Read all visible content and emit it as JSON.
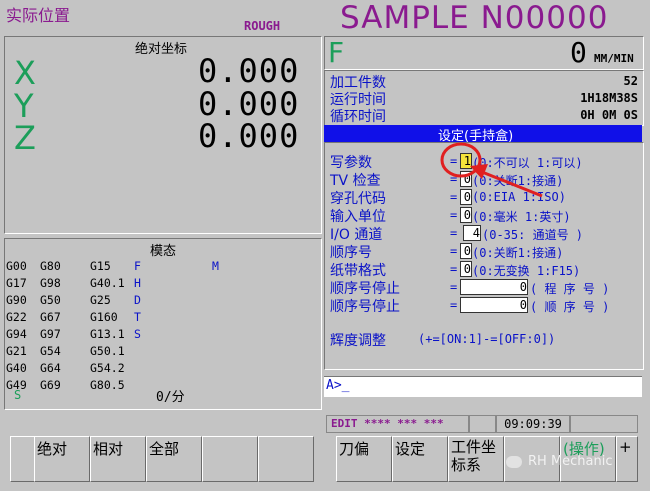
{
  "header": {
    "screen_title": "实际位置",
    "mode": "ROUGH",
    "program": "SAMPLE N00000"
  },
  "absolute": {
    "title": "绝对坐标",
    "axes": [
      {
        "letter": "X",
        "value": "0.000"
      },
      {
        "letter": "Y",
        "value": "0.000"
      },
      {
        "letter": "Z",
        "value": "0.000"
      }
    ]
  },
  "feed": {
    "letter": "F",
    "value": "0",
    "unit": "MM/MIN"
  },
  "info": [
    {
      "label": "加工件数",
      "value": "52"
    },
    {
      "label": "运行时间",
      "value": "1H18M38S"
    },
    {
      "label": "循环时间",
      "value": "0H 0M 0S"
    }
  ],
  "settings": {
    "title": "设定(手持盒)",
    "rows": [
      {
        "label": "写参数",
        "value": "1",
        "desc": "(0:不可以    1:可以)"
      },
      {
        "label": "TV  检查",
        "value": "0",
        "desc": "(0:关断1:接通)"
      },
      {
        "label": "穿孔代码",
        "value": "0",
        "desc": "(0:EIA    1:ISO)"
      },
      {
        "label": "输入单位",
        "value": "0",
        "desc": "(0:毫米    1:英寸)"
      },
      {
        "label": "I/O  通道",
        "value": "4",
        "desc": "(0-35: 通道号    )"
      },
      {
        "label": "顺序号",
        "value": "0",
        "desc": "(0:关断1:接通)"
      },
      {
        "label": "纸带格式",
        "value": "0",
        "desc": "(0:无变换  1:F15)"
      },
      {
        "label": "顺序号停止",
        "value": "0",
        "desc": "( 程 序 号  )"
      },
      {
        "label": "顺序号停止",
        "value": "0",
        "desc": "( 顺 序 号  )"
      }
    ],
    "brightness_label": "辉度调整",
    "brightness_desc": "(+=[ON:1]-=[OFF:0])"
  },
  "modal": {
    "title": "模态",
    "rows": [
      [
        "G00",
        "G80",
        "G15",
        "F",
        "",
        "M"
      ],
      [
        "G17",
        "G98",
        "G40.1",
        "H",
        "",
        ""
      ],
      [
        "G90",
        "G50",
        "G25",
        "D",
        "",
        ""
      ],
      [
        "G22",
        "G67",
        "G160",
        "T",
        "",
        ""
      ],
      [
        "G94",
        "G97",
        "G13.1",
        "S",
        "",
        ""
      ],
      [
        "G21",
        "G54",
        "G50.1",
        "",
        "",
        ""
      ],
      [
        "G40",
        "G64",
        "G54.2",
        "",
        "",
        ""
      ],
      [
        "G49",
        "G69",
        "G80.5",
        "",
        "",
        ""
      ]
    ],
    "s_label": "S",
    "feed_per_min": "0/分"
  },
  "input_prompt": "A>_",
  "status": {
    "mode": "EDIT **** *** ***",
    "time": "09:09:39"
  },
  "softkeys": {
    "left": [
      "绝对",
      "相对",
      "全部",
      "",
      ""
    ],
    "right": [
      "刀偏",
      "设定",
      "工件坐标系",
      "",
      "(操作)",
      "+"
    ]
  },
  "watermark": "RH Mechanic",
  "colors": {
    "label_blue": "#0a12c8",
    "title_purple": "#8a1a8f",
    "axis_green": "#1c9e5a",
    "header_bar": "#1010e8"
  }
}
